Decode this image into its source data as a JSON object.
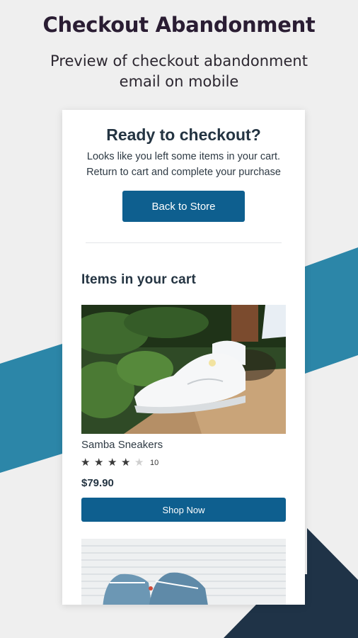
{
  "header": {
    "title": "Checkout Abandonment",
    "subtitle": "Preview of checkout abandonment email on mobile"
  },
  "email": {
    "heading": "Ready to checkout?",
    "body": "Looks like you left some items in your cart. Return to cart and complete your purchase",
    "back_button_label": "Back to Store",
    "cart_heading": "Items in your cart",
    "items": [
      {
        "name": "Samba Sneakers",
        "rating": 4,
        "rating_max": 5,
        "review_count": "10",
        "price": "$79.90",
        "button_label": "Shop Now"
      }
    ]
  },
  "colors": {
    "background": "#efefef",
    "accent_blue": "#0e5f8f",
    "band_blue": "#2c86a8",
    "navy": "#1f3347",
    "heading_text": "#243442"
  },
  "icons": {
    "star_filled": "star-filled-icon",
    "star_empty": "star-empty-icon"
  }
}
